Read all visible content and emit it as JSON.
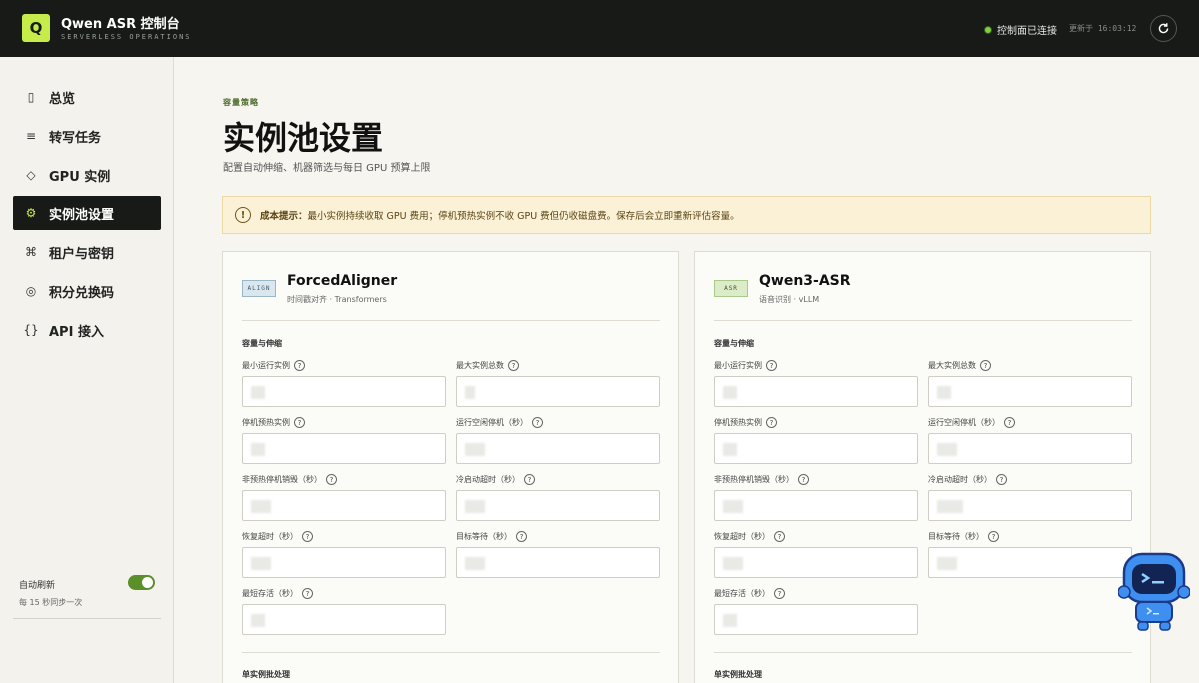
{
  "header": {
    "logo_letter": "Q",
    "title": "Qwen ASR 控制台",
    "subtitle": "SERVERLESS OPERATIONS",
    "status": "控制面已连接",
    "updated": "更新于 16:03:12",
    "refresh_icon": "refresh-icon",
    "status_color": "#7bd23a"
  },
  "sidebar": {
    "items": [
      {
        "icon": "▯",
        "label": "总览"
      },
      {
        "icon": "≡",
        "label": "转写任务"
      },
      {
        "icon": "◇",
        "label": "GPU 实例"
      },
      {
        "icon": "⚙",
        "label": "实例池设置"
      },
      {
        "icon": "⌘",
        "label": "租户与密钥"
      },
      {
        "icon": "◎",
        "label": "积分兑换码"
      },
      {
        "icon": "{}",
        "label": "API 接入"
      }
    ],
    "active_index": 3,
    "auto_refresh_label": "自动刷新",
    "auto_refresh_sub": "每 15 秒同步一次",
    "auto_refresh_on": true
  },
  "main": {
    "eyebrow": "容量策略",
    "title": "实例池设置",
    "description": "配置自动伸缩、机器筛选与每日 GPU 预算上限",
    "notice_strong": "成本提示：",
    "notice_text": "最小实例持续收取 GPU 费用；停机预热实例不收 GPU 费但仍收磁盘费。保存后会立即重新评估容量。",
    "accent_color": "#c6ec4a"
  },
  "cards": [
    {
      "badge": "ALIGN",
      "title": "ForcedAligner",
      "sub": "时间戳对齐 · Transformers",
      "section1": "容量与伸缩",
      "section2": "单实例批处理",
      "fields": [
        "最小运行实例",
        "最大实例总数",
        "停机预热实例",
        "运行空闲停机（秒）",
        "非预热停机销毁（秒）",
        "冷启动超时（秒）",
        "恢复超时（秒）",
        "目标等待（秒）",
        "最短存活（秒）"
      ]
    },
    {
      "badge": "ASR",
      "title": "Qwen3-ASR",
      "sub": "语音识别 · vLLM",
      "section1": "容量与伸缩",
      "section2": "单实例批处理",
      "fields": [
        "最小运行实例",
        "最大实例总数",
        "停机预热实例",
        "运行空闲停机（秒）",
        "非预热停机销毁（秒）",
        "冷启动超时（秒）",
        "恢复超时（秒）",
        "目标等待（秒）",
        "最短存活（秒）"
      ]
    }
  ]
}
